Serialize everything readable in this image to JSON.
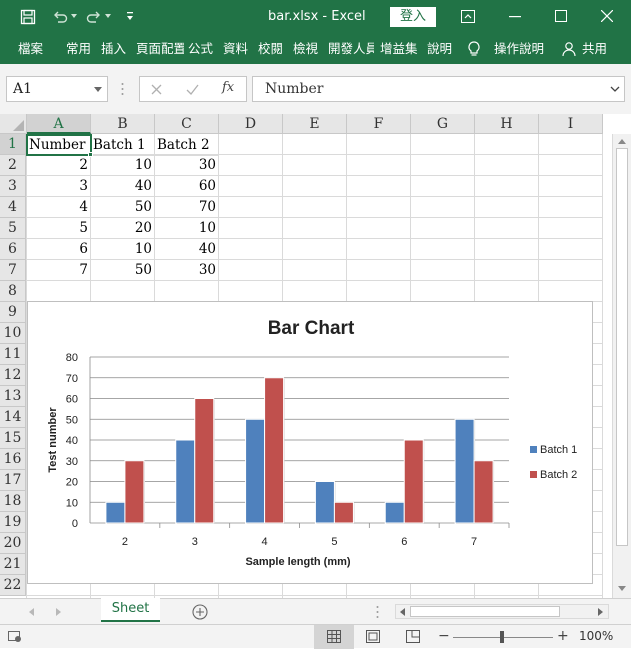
{
  "titlebar": {
    "title": "bar.xlsx - Excel",
    "login": "登入"
  },
  "ribbon": {
    "tabs": [
      "檔案",
      "常用",
      "插入",
      "頁面配置",
      "公式",
      "資料",
      "校閱",
      "檢視",
      "開發人員",
      "增益集",
      "說明"
    ],
    "tell_me": "操作說明",
    "share": "共用"
  },
  "formula_bar": {
    "name_box": "A1",
    "fx": "fx",
    "content": "Number"
  },
  "columns": [
    "A",
    "B",
    "C",
    "D",
    "E",
    "F",
    "G",
    "H",
    "I"
  ],
  "rows": [
    "1",
    "2",
    "3",
    "4",
    "5",
    "6",
    "7",
    "8",
    "9",
    "10",
    "11",
    "12",
    "13",
    "14",
    "15",
    "16",
    "17",
    "18",
    "19",
    "20",
    "21",
    "22"
  ],
  "cells": {
    "header": [
      "Number",
      "Batch 1",
      "Batch 2"
    ],
    "data": [
      [
        "2",
        "10",
        "30"
      ],
      [
        "3",
        "40",
        "60"
      ],
      [
        "4",
        "50",
        "70"
      ],
      [
        "5",
        "20",
        "10"
      ],
      [
        "6",
        "10",
        "40"
      ],
      [
        "7",
        "50",
        "30"
      ]
    ]
  },
  "chart_data": {
    "type": "bar",
    "title": "Bar Chart",
    "xlabel": "Sample length (mm)",
    "ylabel": "Test number",
    "categories": [
      "2",
      "3",
      "4",
      "5",
      "6",
      "7"
    ],
    "series": [
      {
        "name": "Batch 1",
        "values": [
          10,
          40,
          50,
          20,
          10,
          50
        ],
        "color": "#4f81bd"
      },
      {
        "name": "Batch 2",
        "values": [
          30,
          60,
          70,
          10,
          40,
          30
        ],
        "color": "#c0504d"
      }
    ],
    "ylim": [
      0,
      80
    ],
    "yticks": [
      "0",
      "10",
      "20",
      "30",
      "40",
      "50",
      "60",
      "70",
      "80"
    ],
    "grid": true,
    "legend": "right"
  },
  "sheet_tabs": {
    "active": "Sheet"
  },
  "statusbar": {
    "zoom": "100%",
    "minus": "−",
    "plus": "+"
  }
}
